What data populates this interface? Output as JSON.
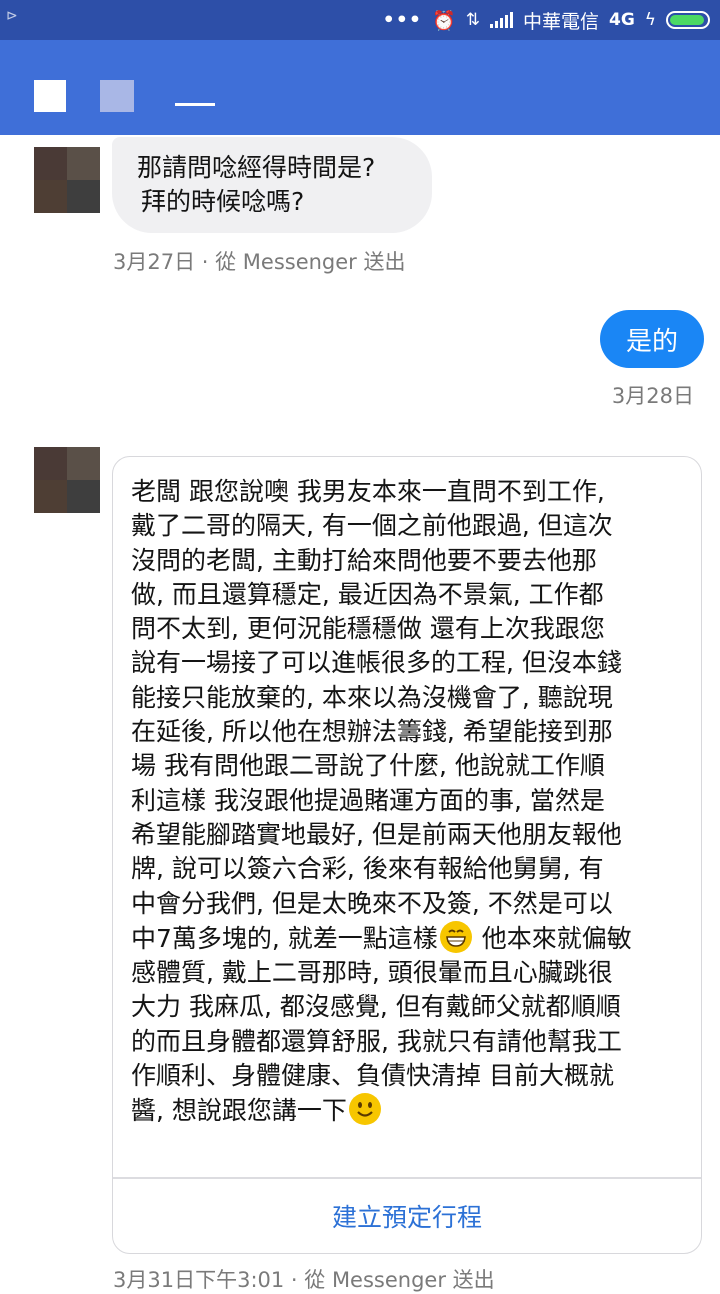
{
  "status_bar": {
    "left_text": "⊳",
    "carrier": "中華電信",
    "network": "4G"
  },
  "header": {},
  "messages": {
    "m1": {
      "lines": [
        "那請問唸經得時間是?",
        "拜的時候唸嗎?"
      ],
      "meta": "3月27日 · 從 Messenger 送出"
    },
    "m2": {
      "text": "是的",
      "meta": "3月28日"
    },
    "m3": {
      "text_part1": "老闆 跟您說噢 我男友本來一直問不到工作,\n戴了二哥的隔天, 有一個之前他跟過, 但這次\n沒問的老闆, 主動打給來問他要不要去他那\n做, 而且還算穩定, 最近因為不景氣, 工作都\n問不太到, 更何況能穩穩做 還有上次我跟您\n說有一場接了可以進帳很多的工程, 但沒本錢\n能接只能放棄的, 本來以為沒機會了, 聽說現\n在延後, 所以他在想辦法籌錢, 希望能接到那\n場 我有問他跟二哥說了什麼, 他說就工作順\n利這樣 我沒跟他提過賭運方面的事, 當然是\n希望能腳踏實地最好, 但是前兩天他朋友報他\n牌, 說可以簽六合彩, 後來有報給他舅舅, 有\n中會分我們, 但是太晚來不及簽, 不然是可以\n中7萬多塊的, 就差一點這樣",
      "text_part2": " 他本來就偏敏\n感體質, 戴上二哥那時, 頭很暈而且心臟跳很\n大力 我麻瓜, 都沒感覺, 但有戴師父就都順順\n的而且身體都還算舒服, 我就只有請他幫我工\n作順利、身體健康、負債快清掉 目前大概就\n醬, 想說跟您講一下",
      "action": "建立預定行程",
      "meta": "3月31日下午3:01 · 從 Messenger 送出"
    }
  }
}
